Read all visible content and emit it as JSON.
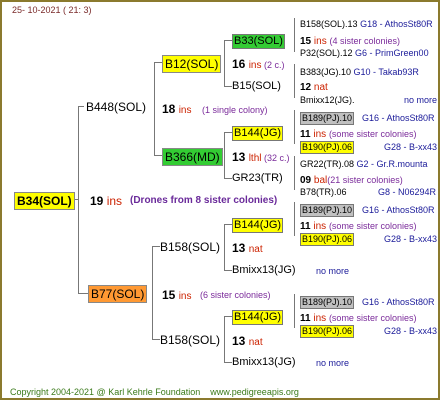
{
  "header": {
    "date": "25- 10-2021 ( 21: 3)"
  },
  "footer": {
    "copyright": "Copyright 2004-2021 @ Karl Kehrle Foundation",
    "site": "www.pedigreeapis.org"
  },
  "root": {
    "name": "B34(SOL)",
    "year": "19",
    "suffix": "ins",
    "note": "(Drones from 8 sister colonies)"
  },
  "sire": {
    "name": "B448(SOL)",
    "year": "18",
    "suffix": "ins",
    "note": "(1 single colony)"
  },
  "dam": {
    "name": "B77(SOL)",
    "year": "15",
    "suffix": "ins",
    "note": "(6 sister colonies)"
  },
  "b12": {
    "name": "B12(SOL)",
    "year": "16",
    "suffix": "ins",
    "note": "(2 c.)"
  },
  "b366": {
    "name": "B366(MD)",
    "year": "13",
    "suffix": "lthl",
    "note": "(32 c.)"
  },
  "b158a": {
    "name": "B158(SOL)",
    "year": "13",
    "suffix": "nat"
  },
  "b158b": {
    "name": "B158(SOL)",
    "year": "13",
    "suffix": "nat"
  },
  "g33": {
    "name": "B33(SOL)",
    "year": "15",
    "suffix": "ins",
    "note": "(4 sister colonies)"
  },
  "g15": {
    "name": "B15(SOL)",
    "year": "12",
    "suffix": "nat"
  },
  "g144a": {
    "name": "B144(JG)",
    "year": "11",
    "suffix": "ins",
    "note": "(some sister colonies)"
  },
  "g23": {
    "name": "GR23(TR)",
    "year": "09",
    "suffix": "bal",
    "note": "(21 sister colonies)"
  },
  "g144b": {
    "name": "B144(JG)",
    "year": "11",
    "suffix": "ins",
    "note": "(some sister colonies)"
  },
  "gmix1": {
    "name": "Bmixx13(JG)",
    "more": "no more"
  },
  "g144c": {
    "name": "B144(JG)",
    "year": "11",
    "suffix": "ins",
    "note": "(some sister colonies)"
  },
  "gmix2": {
    "name": "Bmixx13(JG)",
    "more": "no more"
  },
  "r": {
    "r1a": "B158(SOL).13",
    "r1b": "G18 - AthosSt80R",
    "r2a": "P32(SOL).12",
    "r2b": "G6 - PrimGreen00",
    "r3a": "B383(JG).10",
    "r3b": "G10 - Takab93R",
    "r4a": "Bmixx12(JG).",
    "r4b": "no more",
    "r5a": "B189(PJ).10",
    "r5b": "G16 - AthosSt80R",
    "r6a": "B190(PJ).06",
    "r6b": "G28 - B-xx43",
    "r7a": "GR22(TR).08",
    "r7b": "G2 - Gr.R.mounta",
    "r8a": "B78(TR).06",
    "r8b": "G8 - N06294R",
    "r9a": "B189(PJ).10",
    "r9b": "G16 - AthosSt80R",
    "r10a": "B190(PJ).06",
    "r10b": "G28 - B-xx43",
    "r11a": "B189(PJ).10",
    "r11b": "G16 - AthosSt80R",
    "r12a": "B190(PJ).06",
    "r12b": "G28 - B-xx43"
  }
}
